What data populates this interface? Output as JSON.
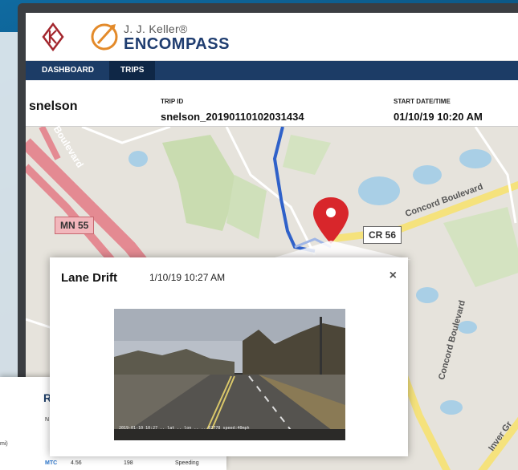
{
  "brand": {
    "small": "J. J. Keller®",
    "big": "ENCOMPASS"
  },
  "nav": {
    "tabs": [
      {
        "label": "DASHBOARD",
        "active": false
      },
      {
        "label": "TRIPS",
        "active": true
      }
    ]
  },
  "trip": {
    "user": "snelson",
    "trip_id_label": "TRIP ID",
    "trip_id": "snelson_20190110102031434",
    "start_label": "START DATE/TIME",
    "start": "01/10/19 10:20 AM"
  },
  "map": {
    "labels": {
      "mn55": "MN 55",
      "cr56": "CR 56",
      "boulevard": "Boulevard",
      "concord_boulevard": "Concord Boulevard",
      "concord_boulevard_2": "Concord Boulevard",
      "inver_gr": "Inver Gr"
    },
    "marker_color": "#d8262b"
  },
  "popup": {
    "title": "Lane Drift",
    "time": "1/10/19 10:27 AM",
    "close": "×",
    "video_stamp": "2019-01-10 10:27 ..  lat ..  lon ..  ...62778  speed:40mph"
  },
  "background_card": {
    "heading": "Re",
    "col": "N",
    "mi": "mi)",
    "row": {
      "code": "MTC",
      "a": "4.56",
      "b": "198",
      "type": "Speeding"
    }
  },
  "colors": {
    "navy": "#1c3c66",
    "brand_orange": "#e38a2a",
    "route_blue": "#2f61c9",
    "road_pink": "#e48a92"
  }
}
